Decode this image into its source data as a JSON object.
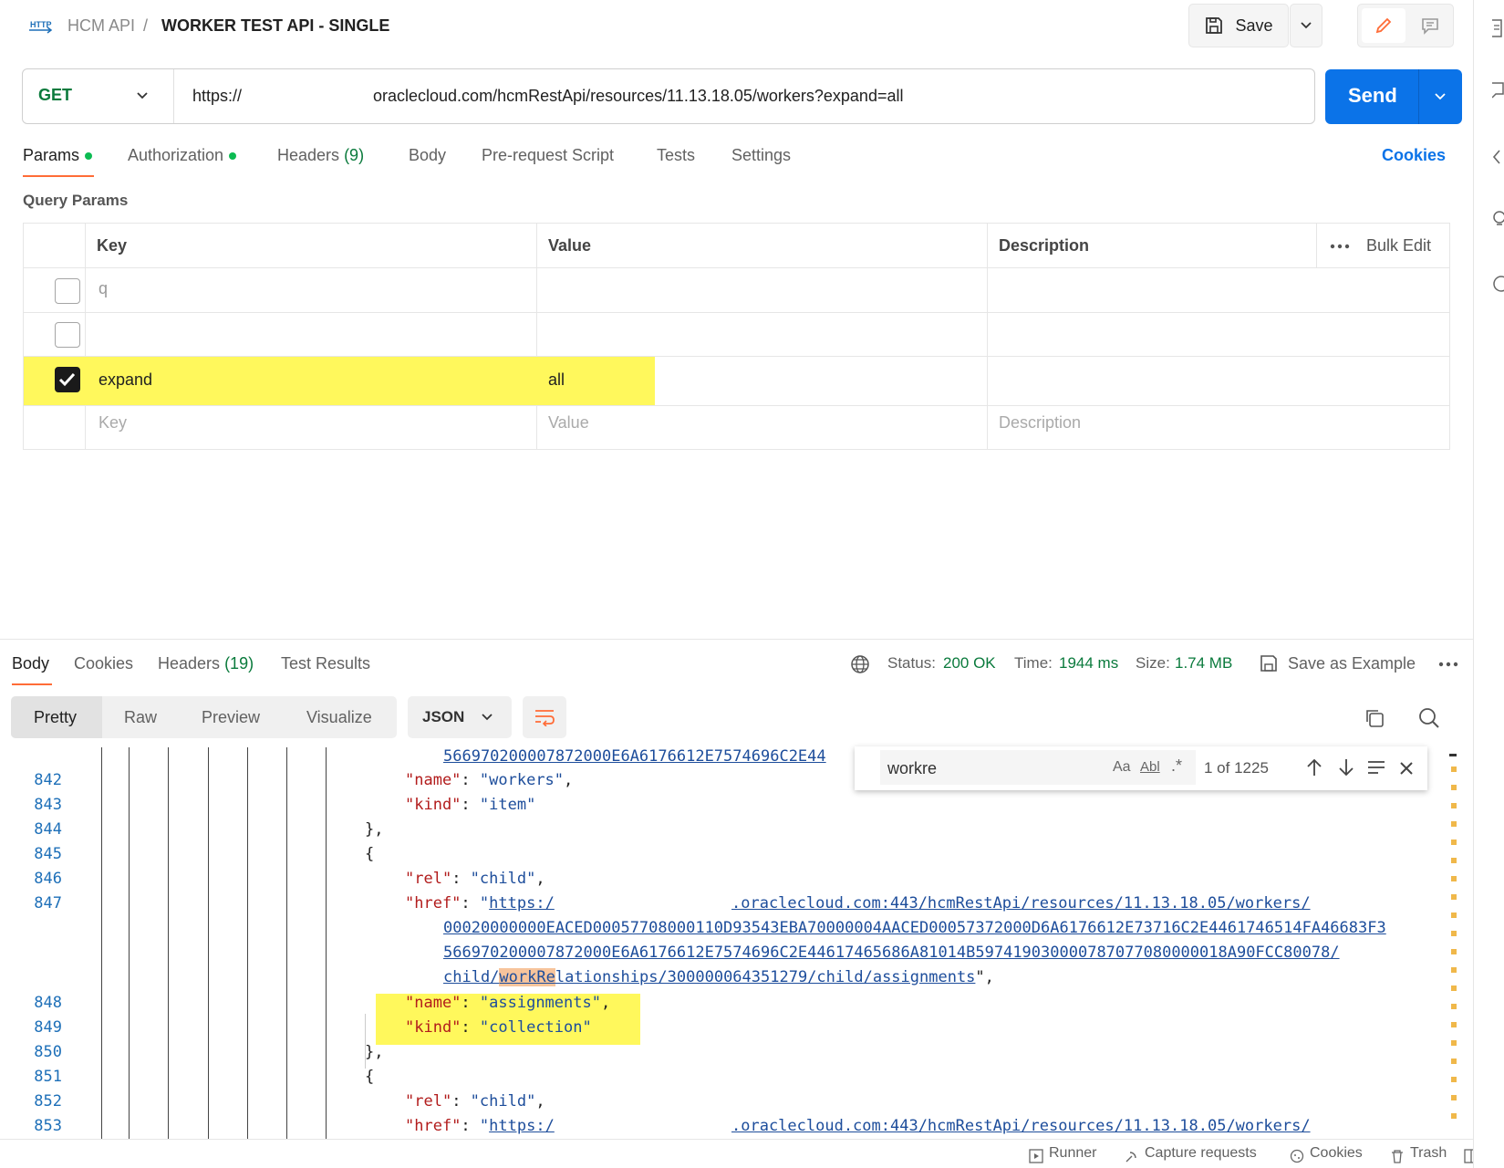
{
  "breadcrumb": {
    "collection": "HCM API",
    "separator": "/",
    "request": "WORKER TEST API - SINGLE"
  },
  "toolbar": {
    "save_label": "Save"
  },
  "request": {
    "method": "GET",
    "url_prefix": "https://",
    "url_main": "oraclecloud.com/hcmRestApi/resources/11.13.18.05/workers?expand=all",
    "send_label": "Send"
  },
  "tabs": [
    {
      "label": "Params"
    },
    {
      "label": "Authorization"
    },
    {
      "label": "Headers",
      "count": "(9)"
    },
    {
      "label": "Body"
    },
    {
      "label": "Pre-request Script"
    },
    {
      "label": "Tests"
    },
    {
      "label": "Settings"
    }
  ],
  "cookies_link": "Cookies",
  "query_params": {
    "title": "Query Params",
    "headers": {
      "key": "Key",
      "value": "Value",
      "description": "Description",
      "bulk_edit": "Bulk Edit"
    },
    "rows": [
      {
        "key": "q",
        "value": "",
        "checked": false
      },
      {
        "key": "",
        "value": "",
        "checked": false
      },
      {
        "key": "expand",
        "value": "all",
        "checked": true
      }
    ],
    "placeholder": {
      "key": "Key",
      "value": "Value",
      "description": "Description"
    }
  },
  "response": {
    "tabs": [
      {
        "label": "Body"
      },
      {
        "label": "Cookies"
      },
      {
        "label": "Headers",
        "count": "(19)"
      },
      {
        "label": "Test Results"
      }
    ],
    "status_label": "Status:",
    "status_value": "200 OK",
    "time_label": "Time:",
    "time_value": "1944 ms",
    "size_label": "Size:",
    "size_value": "1.74 MB",
    "save_example": "Save as Example",
    "views": [
      "Pretty",
      "Raw",
      "Preview",
      "Visualize"
    ],
    "format": "JSON"
  },
  "find": {
    "query": "workre",
    "match_case": "Aa",
    "whole_word": "Abl",
    "regex": ".*",
    "count": "1 of 1225"
  },
  "code": {
    "l0": "566970200007872000E6A6176612E7574696C2E44",
    "l842": {
      "num": "842",
      "key": "\"name\"",
      "val": "\"workers\""
    },
    "l843": {
      "num": "843",
      "key": "\"kind\"",
      "val": "\"item\""
    },
    "l844": {
      "num": "844",
      "text": "},"
    },
    "l845": {
      "num": "845",
      "text": "{"
    },
    "l846": {
      "num": "846",
      "key": "\"rel\"",
      "val": "\"child\""
    },
    "l847": {
      "num": "847",
      "key": "\"href\"",
      "q": "\"",
      "u1": "https:/",
      "u2": ".oraclecloud.com:443/hcmRestApi/resources/11.13.18.05/workers/"
    },
    "w1": "00020000000EACED00057708000110D93543EBA70000004AACED00057372000D6A6176612E73716C2E4461746514FA46683F3",
    "w2": "566970200007872000E6A6176612E7574696C2E44617465686A81014B597419030000787077080000018A90FCC80078/",
    "w3a": "child/",
    "w3b": "workRe",
    "w3c": "lationships/300000064351279/child/assignments",
    "w3d": "\",",
    "l848": {
      "num": "848",
      "key": "\"name\"",
      "val": "\"assignments\""
    },
    "l849": {
      "num": "849",
      "key": "\"kind\"",
      "val": "\"collection\""
    },
    "l850": {
      "num": "850",
      "text": "},"
    },
    "l851": {
      "num": "851",
      "text": "{"
    },
    "l852": {
      "num": "852",
      "key": "\"rel\"",
      "val": "\"child\""
    },
    "l853": {
      "num": "853",
      "key": "\"href\"",
      "q": "\"",
      "u1": "https:/",
      "u2": ".oraclecloud.com:443/hcmRestApi/resources/11.13.18.05/workers/"
    }
  },
  "footer": {
    "runner": "Runner",
    "capture": "Capture requests",
    "cookies": "Cookies",
    "trash": "Trash"
  },
  "colors": {
    "accent": "#0b73e8",
    "orange": "#ff6c37",
    "green": "#0cbb52",
    "highlight": "#fff85c"
  }
}
